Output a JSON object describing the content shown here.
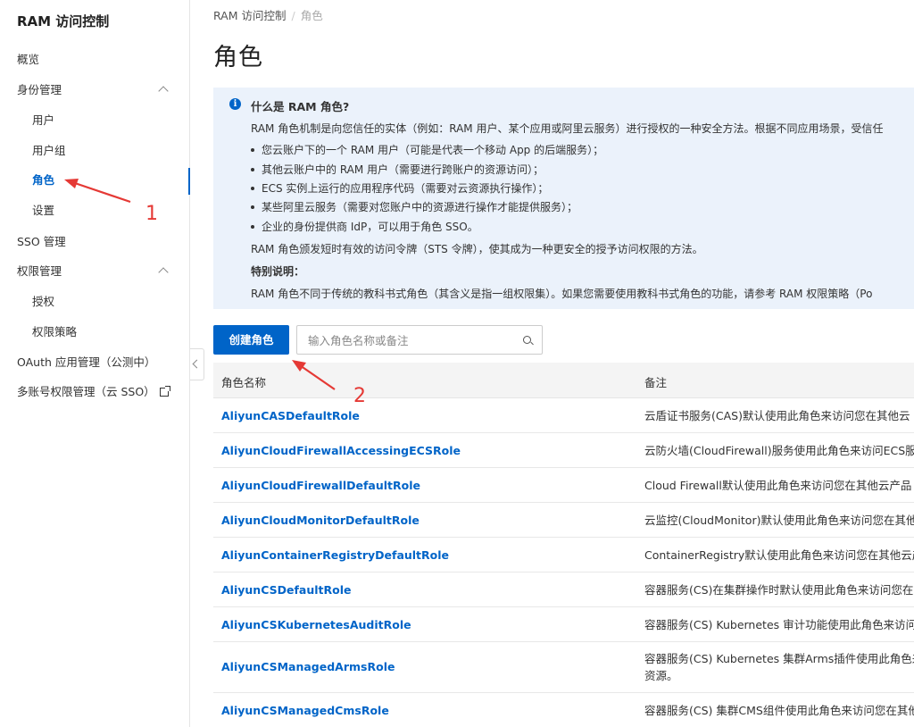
{
  "sidebar": {
    "title": "RAM 访问控制",
    "items": [
      {
        "label": "概览"
      },
      {
        "label": "身份管理"
      },
      {
        "label": "用户"
      },
      {
        "label": "用户组"
      },
      {
        "label": "角色"
      },
      {
        "label": "设置"
      },
      {
        "label": "SSO 管理"
      },
      {
        "label": "权限管理"
      },
      {
        "label": "授权"
      },
      {
        "label": "权限策略"
      },
      {
        "label": "OAuth 应用管理（公测中）"
      },
      {
        "label": "多账号权限管理（云 SSO）"
      }
    ]
  },
  "breadcrumb": {
    "root": "RAM 访问控制",
    "sep": "/",
    "current": "角色"
  },
  "page_title": "角色",
  "info": {
    "icon_text": "i",
    "title": "什么是 RAM 角色?",
    "intro": "RAM 角色机制是向您信任的实体（例如：RAM 用户、某个应用或阿里云服务）进行授权的一种安全方法。根据不同应用场景，受信任",
    "bullets": [
      "您云账户下的一个 RAM 用户（可能是代表一个移动 App 的后端服务）；",
      "其他云账户中的 RAM 用户（需要进行跨账户的资源访问）；",
      "ECS 实例上运行的应用程序代码（需要对云资源执行操作）；",
      "某些阿里云服务（需要对您账户中的资源进行操作才能提供服务）；",
      "企业的身份提供商 IdP，可以用于角色 SSO。"
    ],
    "sts_line": "RAM 角色颁发短时有效的访问令牌（STS 令牌），使其成为一种更安全的授予访问权限的方法。",
    "special_title": "特别说明：",
    "special_text": "RAM 角色不同于传统的教科书式角色（其含义是指一组权限集）。如果您需要使用教科书式角色的功能，请参考 RAM 权限策略（Po"
  },
  "toolbar": {
    "create_label": "创建角色",
    "search_placeholder": "输入角色名称或备注"
  },
  "table": {
    "headers": [
      "角色名称",
      "备注"
    ],
    "rows": [
      {
        "name": "AliyunCASDefaultRole",
        "note": "云盾证书服务(CAS)默认使用此角色来访问您在其他云"
      },
      {
        "name": "AliyunCloudFirewallAccessingECSRole",
        "note": "云防火墙(CloudFirewall)服务使用此角色来访问ECS服"
      },
      {
        "name": "AliyunCloudFirewallDefaultRole",
        "note": "Cloud Firewall默认使用此角色来访问您在其他云产品"
      },
      {
        "name": "AliyunCloudMonitorDefaultRole",
        "note": "云监控(CloudMonitor)默认使用此角色来访问您在其他"
      },
      {
        "name": "AliyunContainerRegistryDefaultRole",
        "note": "ContainerRegistry默认使用此角色来访问您在其他云产"
      },
      {
        "name": "AliyunCSDefaultRole",
        "note": "容器服务(CS)在集群操作时默认使用此角色来访问您在"
      },
      {
        "name": "AliyunCSKubernetesAuditRole",
        "note": "容器服务(CS) Kubernetes 审计功能使用此角色来访问"
      },
      {
        "name": "AliyunCSManagedArmsRole",
        "note": "容器服务(CS) Kubernetes 集群Arms插件使用此角色来",
        "note2": "资源。"
      },
      {
        "name": "AliyunCSManagedCmsRole",
        "note": "容器服务(CS) 集群CMS组件使用此角色来访问您在其他"
      }
    ]
  },
  "annotations": {
    "label1": "1",
    "label2": "2",
    "color": "#e53935"
  },
  "colors": {
    "accent": "#0064c8",
    "info_bg": "#ebf2fb"
  }
}
